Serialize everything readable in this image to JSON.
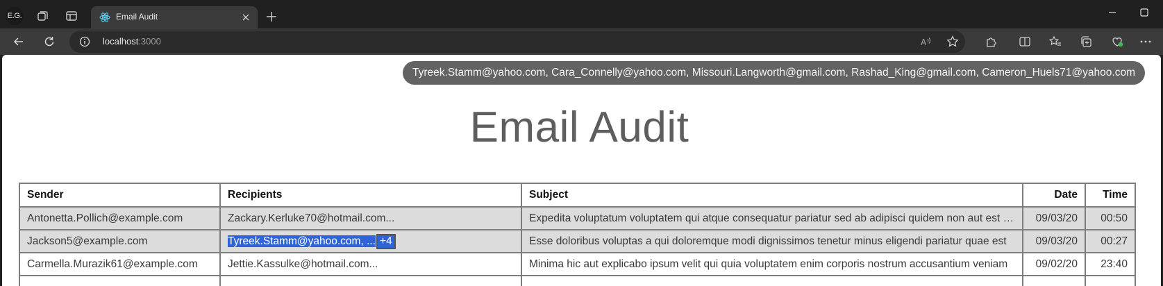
{
  "browser": {
    "profile_initials": "E.G.",
    "tab_title": "Email Audit",
    "url_host": "localhost",
    "url_port": ":3000"
  },
  "tooltip": "Tyreek.Stamm@yahoo.com, Cara_Connelly@yahoo.com, Missouri.Langworth@gmail.com, Rashad_King@gmail.com, Cameron_Huels71@yahoo.com",
  "page": {
    "title": "Email Audit"
  },
  "table": {
    "headers": {
      "sender": "Sender",
      "recipients": "Recipients",
      "subject": "Subject",
      "date": "Date",
      "time": "Time"
    },
    "rows": [
      {
        "sender": "Antonetta.Pollich@example.com",
        "recipients": "Zackary.Kerluke70@hotmail.com...",
        "subject": "Expedita voluptatum voluptatem qui atque consequatur pariatur sed ab adipisci quidem non aut est quia",
        "date": "09/03/20",
        "time": "00:50"
      },
      {
        "sender": "Jackson5@example.com",
        "recipients": "Tyreek.Stamm@yahoo.com, ...",
        "recipients_badge": "+4",
        "subject": "Esse doloribus voluptas a qui doloremque modi dignissimos tenetur minus eligendi pariatur quae est",
        "date": "09/03/20",
        "time": "00:27"
      },
      {
        "sender": "Carmella.Murazik61@example.com",
        "recipients": "Jettie.Kassulke@hotmail.com...",
        "subject": "Minima hic aut explicabo ipsum velit qui quia voluptatem enim corporis nostrum accusantium veniam",
        "date": "09/02/20",
        "time": "23:40"
      }
    ]
  }
}
